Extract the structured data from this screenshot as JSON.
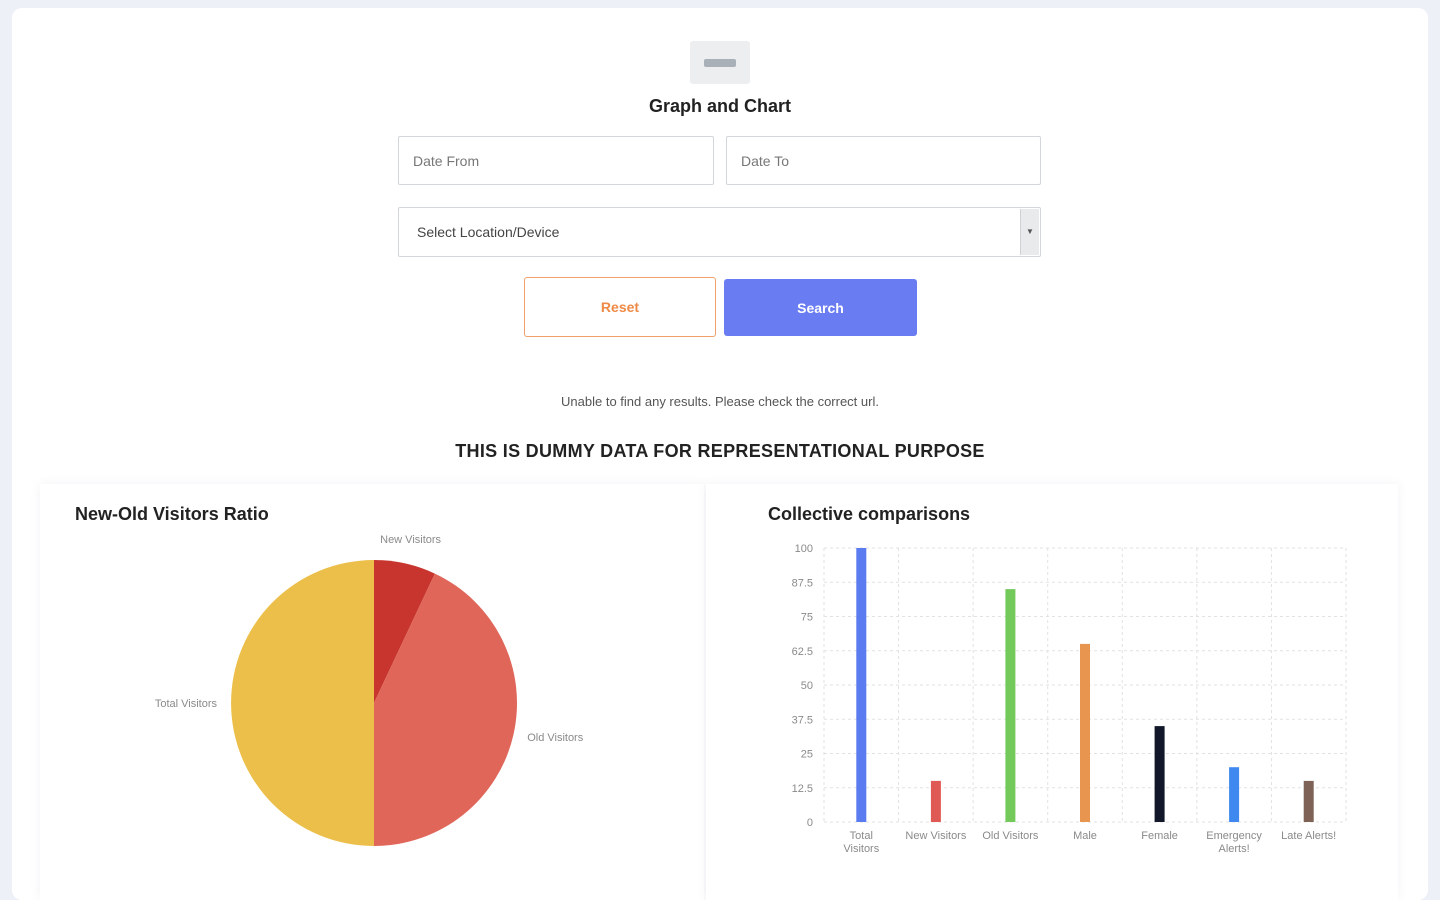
{
  "header": {
    "title": "Graph and Chart"
  },
  "filters": {
    "date_from_placeholder": "Date From",
    "date_to_placeholder": "Date To",
    "location_select_value": "Select Location/Device",
    "select_arrow_glyph": "▼"
  },
  "actions": {
    "reset_label": "Reset",
    "search_label": "Search"
  },
  "messages": {
    "error": "Unable to find any results. Please check the correct url.",
    "dummy_note": "THIS IS DUMMY DATA FOR REPRESENTATIONAL PURPOSE"
  },
  "colors": {
    "primary": "#6a7cf2",
    "reset_text": "#ee8a45",
    "reset_border": "#f0a06a"
  },
  "chart_data": [
    {
      "type": "pie",
      "title": "New-Old Visitors Ratio",
      "labels": [
        "New Visitors",
        "Old Visitors",
        "Total Visitors"
      ],
      "values": [
        7,
        43,
        50
      ],
      "colors": [
        "#c8352e",
        "#e0665a",
        "#ecbf4a"
      ]
    },
    {
      "type": "bar",
      "title": "Collective comparisons",
      "categories": [
        "Total Visitors",
        "New Visitors",
        "Old Visitors",
        "Male",
        "Female",
        "Emergency Alerts!",
        "Late Alerts!"
      ],
      "category_lines": [
        [
          "Total",
          "Visitors"
        ],
        [
          "New Visitors"
        ],
        [
          "Old Visitors"
        ],
        [
          "Male"
        ],
        [
          "Female"
        ],
        [
          "Emergency",
          "Alerts!"
        ],
        [
          "Late Alerts!"
        ]
      ],
      "values": [
        100,
        15,
        85,
        65,
        35,
        20,
        15
      ],
      "colors": [
        "#5b7bf0",
        "#e05a55",
        "#74c95b",
        "#e8954f",
        "#121829",
        "#3e88f0",
        "#7d6255"
      ],
      "ylim": [
        0,
        100
      ],
      "yticks": [
        "0",
        "12.5",
        "25",
        "37.5",
        "50",
        "62.5",
        "75",
        "87.5",
        "100"
      ],
      "grid": true
    }
  ]
}
